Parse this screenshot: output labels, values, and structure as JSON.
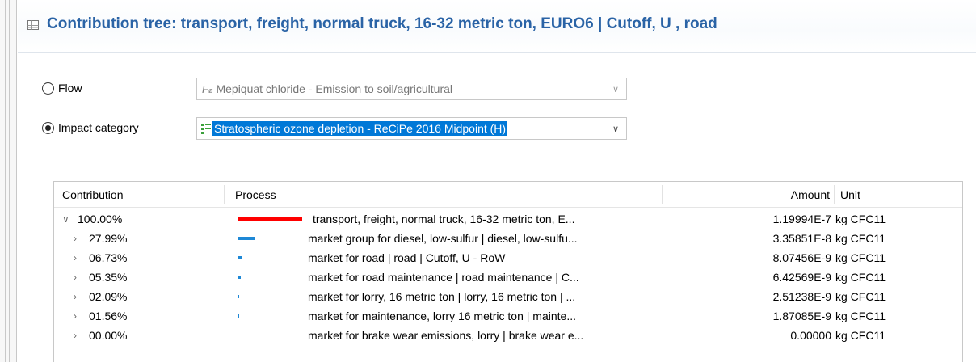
{
  "header": {
    "title": "Contribution tree:  transport, freight, normal truck, 16-32 metric ton, EURO6 | Cutoff, U , road",
    "icon": "table-icon"
  },
  "selector": {
    "flow": {
      "label": "Flow",
      "selected": false,
      "value": "Mepiquat chloride - Emission to soil/agricultural",
      "icon": "fx-flow-icon"
    },
    "impact": {
      "label": "Impact category",
      "selected": true,
      "value": "Stratospheric ozone depletion - ReCiPe 2016 Midpoint (H)",
      "icon": "impact-category-icon"
    }
  },
  "table": {
    "columns": [
      "Contribution",
      "Process",
      "Amount",
      "Unit"
    ],
    "rows": [
      {
        "level": 0,
        "expanded": true,
        "contribution": "100.00%",
        "share": 1.0,
        "process": "transport, freight, normal truck, 16-32 metric ton, E...",
        "amount": "1.19994E-7",
        "unit": "kg CFC11",
        "bar_color": "#ff0000"
      },
      {
        "level": 1,
        "expanded": false,
        "contribution": "27.99%",
        "share": 0.2799,
        "process": "market group for diesel, low-sulfur | diesel, low-sulfu...",
        "amount": "3.35851E-8",
        "unit": "kg CFC11",
        "bar_color": "#1e88d6"
      },
      {
        "level": 1,
        "expanded": false,
        "contribution": "06.73%",
        "share": 0.0673,
        "process": "market for road | road | Cutoff, U - RoW",
        "amount": "8.07456E-9",
        "unit": "kg CFC11",
        "bar_color": "#1e88d6"
      },
      {
        "level": 1,
        "expanded": false,
        "contribution": "05.35%",
        "share": 0.0535,
        "process": "market for road maintenance | road maintenance | C...",
        "amount": "6.42569E-9",
        "unit": "kg CFC11",
        "bar_color": "#1e88d6"
      },
      {
        "level": 1,
        "expanded": false,
        "contribution": "02.09%",
        "share": 0.0209,
        "process": "market for lorry, 16 metric ton | lorry, 16 metric ton | ...",
        "amount": "2.51238E-9",
        "unit": "kg CFC11",
        "bar_color": "#1e88d6"
      },
      {
        "level": 1,
        "expanded": false,
        "contribution": "01.56%",
        "share": 0.0156,
        "process": "market for maintenance, lorry 16 metric ton | mainte...",
        "amount": "1.87085E-9",
        "unit": "kg CFC11",
        "bar_color": "#1e88d6"
      },
      {
        "level": 1,
        "expanded": false,
        "contribution": "00.00%",
        "share": 0.0,
        "process": "market for brake wear emissions, lorry | brake wear e...",
        "amount": "0.00000",
        "unit": "kg CFC11",
        "bar_color": "#1e88d6"
      }
    ]
  }
}
